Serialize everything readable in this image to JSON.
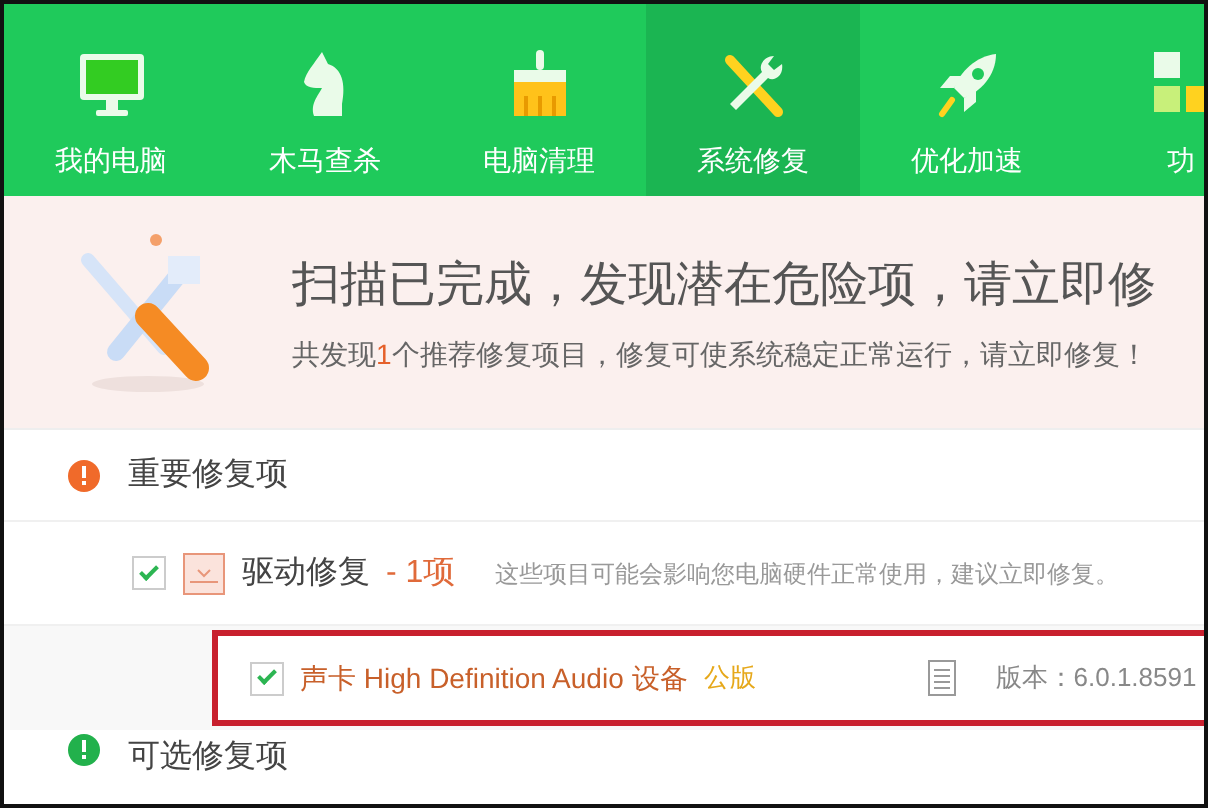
{
  "tabs": [
    {
      "label": "我的电脑",
      "selected": false
    },
    {
      "label": "木马查杀",
      "selected": false
    },
    {
      "label": "电脑清理",
      "selected": false
    },
    {
      "label": "系统修复",
      "selected": true
    },
    {
      "label": "优化加速",
      "selected": false
    },
    {
      "label": "功",
      "selected": false
    }
  ],
  "banner": {
    "title": "扫描已完成，发现潜在危险项，请立即修",
    "subtitle": {
      "before": "共发现",
      "count": "1",
      "after": "个推荐修复项目，修复可使系统稳定正常运行，请立即修复！"
    }
  },
  "sections": [
    {
      "title": "重要修复项",
      "color": "#f06a2a",
      "groups": [
        {
          "title": "驱动修复",
          "count": "- 1项",
          "description": "这些项目可能会影响您电脑硬件正常使用，建议立即修复。",
          "checked": true,
          "items": [
            {
              "name": "声卡 High Definition Audio 设备",
              "tag": "公版",
              "version": "版本：6.0.1.8591",
              "checked": true,
              "highlighted": true
            }
          ]
        }
      ]
    },
    {
      "title": "可选修复项",
      "color": "#22b14c"
    }
  ]
}
